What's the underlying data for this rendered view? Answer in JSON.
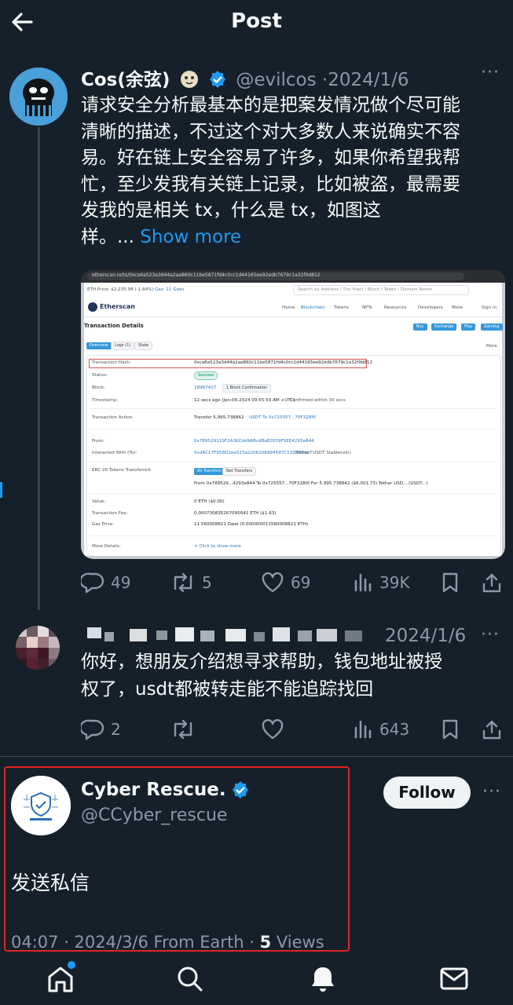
{
  "header": {
    "title": "Post"
  },
  "tweet1": {
    "name": "Cos(余弦)",
    "handle": "@evilcos",
    "date": "·2024/1/6",
    "lines": [
      "请求安全分析最基本的是把案发情况做个尽可能",
      "清晰的描述，不过这个对大多数人来说确实不容",
      "易。好在链上安全容易了许多，如果你希望我帮",
      "忙，至少发我有关链上记录，比如被盗，最需要",
      "发我的是相关 tx，什么是 tx，如图这",
      "样。... "
    ],
    "show_more": "Show more",
    "stats": {
      "replies": "49",
      "reposts": "5",
      "likes": "69",
      "views": "39K"
    }
  },
  "embed": {
    "url": "etherscan.io/tx/0xca6a523a3d44a2aa860c11be5871fd4c0cc1d44165ee92edb7679c1a32f9d812",
    "eth_price": "ETH Price: $2,235.98 (-1.84%)",
    "gas": "Gas: 11 Gwei",
    "search_placeholder": "Search by Address / Txn Hash / Block / Token / Domain Name",
    "logo": "Etherscan",
    "nav": [
      "Home",
      "Blockchain",
      "Tokens",
      "NFTs",
      "Resources",
      "Developers",
      "More",
      "Sign In"
    ],
    "page_title": "Transaction Details",
    "top_buttons": [
      "Buy",
      "Exchange",
      "Play",
      "Gaming"
    ],
    "tabs": [
      "Overview",
      "Logs (1)",
      "State"
    ],
    "more_label": "More",
    "rows": [
      {
        "label": "Transaction Hash:",
        "value": "0xca6a523a3d44a2aa860c11be5871fd4c0cc1d44165ee92edb7679c1a32f9d812"
      },
      {
        "label": "Status:",
        "value": "Success"
      },
      {
        "label": "Block:",
        "value": "18967427",
        "extra": "1 Block Confirmation"
      },
      {
        "label": "Timestamp:",
        "value": "12 secs ago (Jan-06-2024 09:55:59 AM +UTC)",
        "extra": "Confirmed within 30 secs"
      },
      {
        "label": "Transaction Action:",
        "value": "Transfer 5,995.738842",
        "extra": "USDT To 0x725557...70F328f0"
      },
      {
        "label": "From:",
        "value": "0x789529119F2A36Cdd9ABcdBaE0559F5EE4293e844"
      },
      {
        "label": "Interacted With (To):",
        "value": "0xdAC17F958D2ee523a2206206994597C13D831ec7",
        "extra": "(Tether: USDT Stablecoin)"
      },
      {
        "label": "ERC-20 Tokens Transferred:",
        "value": "All Transfers",
        "extra": "Net Transfers"
      },
      {
        "label": "",
        "value": "From 0x789529...4293e844 To 0x725557...70F328f0 For 5,995.738842 ($6,001.73) Tether USD... (USDT...)"
      },
      {
        "label": "Value:",
        "value": "0 ETH ($0.00)"
      },
      {
        "label": "Transaction Fee:",
        "value": "0.000730835267095641 ETH ($1.63)"
      },
      {
        "label": "Gas Price:",
        "value": "11.560008821 Gwei (0.000000011560008821 ETH)"
      },
      {
        "label": "More Details:",
        "value": "+ Click to show more"
      }
    ]
  },
  "tweet2": {
    "date": "2024/1/6",
    "lines": [
      "你好，想朋友介绍想寻求帮助，钱包地址被授",
      "权了，usdt都被转走能不能追踪找回"
    ],
    "stats": {
      "replies": "2",
      "views": "643"
    }
  },
  "tweet3": {
    "name": "Cyber Rescue.",
    "handle": "@CCyber_rescue",
    "follow": "Follow",
    "body": "发送私信",
    "meta": "04:07 · 2024/3/6 From Earth · ",
    "views_count": "5",
    "views_label": " Views"
  },
  "colors": {
    "background": "#15202b",
    "accent": "#1d9bf0",
    "muted": "#8b98a5",
    "highlight": "#e02424"
  }
}
